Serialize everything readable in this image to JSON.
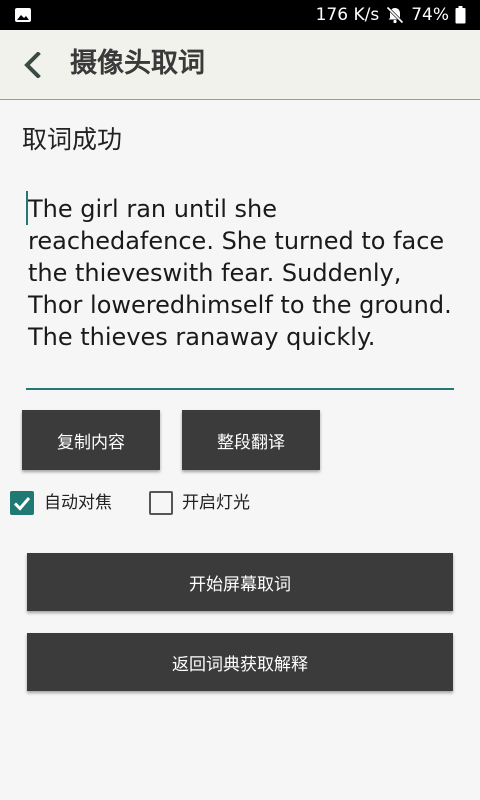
{
  "status_bar": {
    "speed": "176 K/s",
    "battery": "74%",
    "icons": [
      "image-icon",
      "bell-muted-icon",
      "battery-icon"
    ]
  },
  "header": {
    "title": "摄像头取词",
    "back_icon": "chevron-left-icon"
  },
  "main": {
    "result_title": "取词成功",
    "recognized_text": "The girl ran until she reachedafence. She turned to face the thieveswith fear. Suddenly, Thor loweredhimself to the ground. The thieves ranaway quickly.",
    "accent_color": "#1f7a74"
  },
  "buttons": {
    "copy_label": "复制内容",
    "translate_label": "整段翻译",
    "start_screen_label": "开始屏幕取词",
    "return_dict_label": "返回词典获取解释"
  },
  "options": {
    "autofocus_label": "自动对焦",
    "autofocus_checked": true,
    "flash_label": "开启灯光",
    "flash_checked": false
  }
}
